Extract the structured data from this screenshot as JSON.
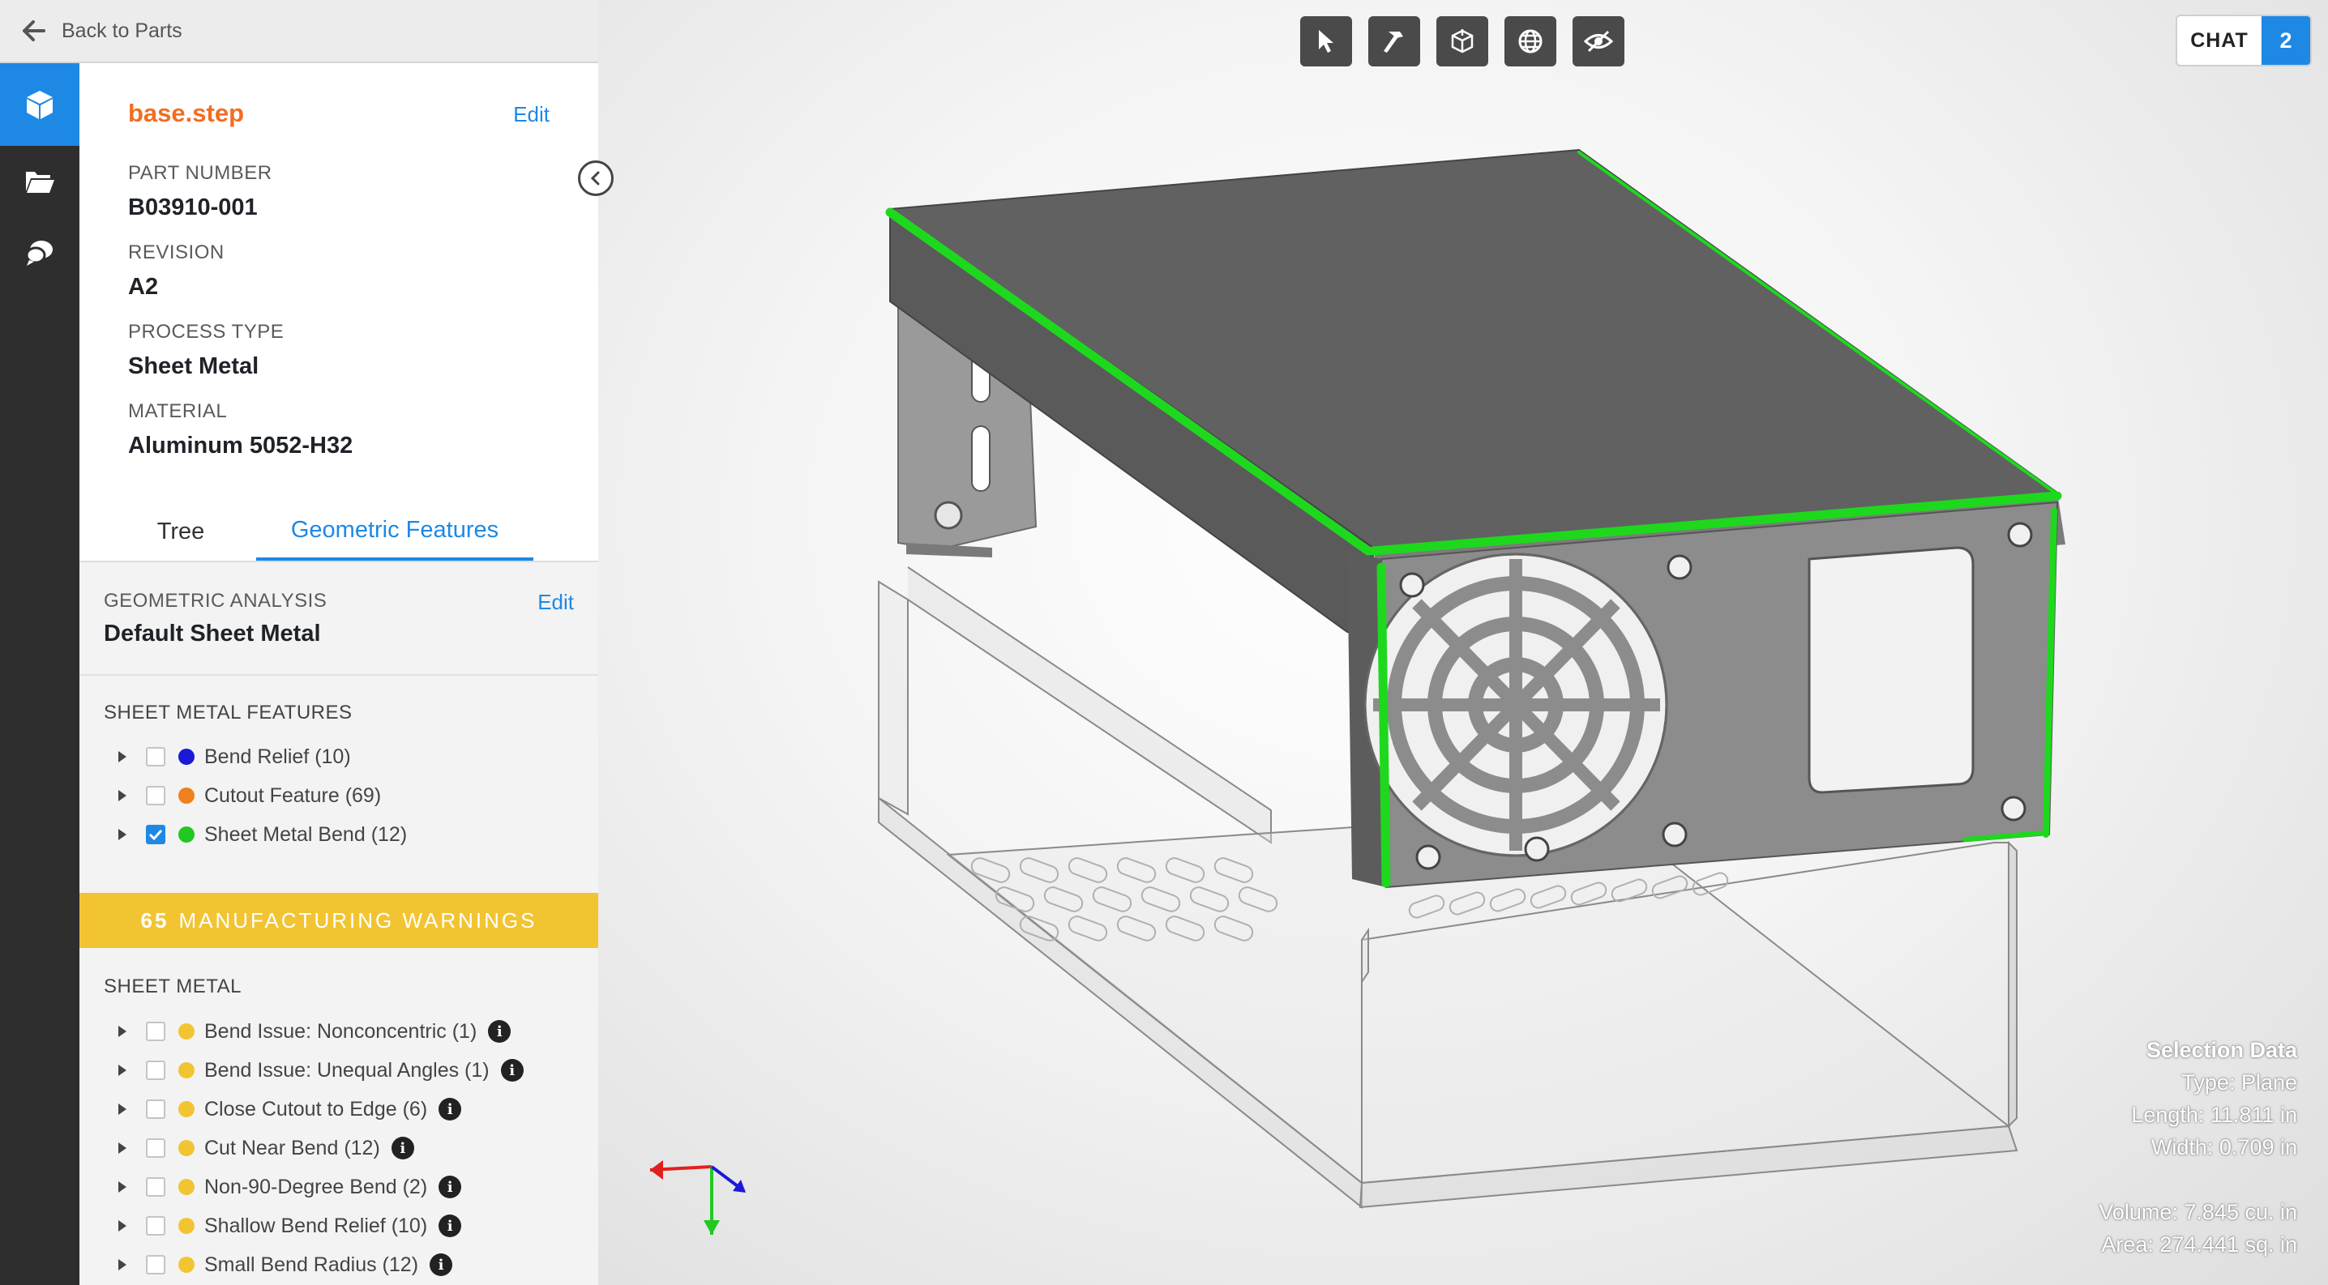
{
  "header": {
    "back_label": "Back to Parts"
  },
  "sidebar_rail": {
    "items": [
      {
        "icon": "cube-icon",
        "active": true
      },
      {
        "icon": "folder-icon",
        "active": false
      },
      {
        "icon": "chat-bubbles-icon",
        "active": false
      }
    ]
  },
  "part": {
    "filename": "base.step",
    "edit_label": "Edit",
    "properties": [
      {
        "label": "PART NUMBER",
        "value": "B03910-001"
      },
      {
        "label": "REVISION",
        "value": "A2"
      },
      {
        "label": "PROCESS TYPE",
        "value": "Sheet Metal"
      },
      {
        "label": "MATERIAL",
        "value": "Aluminum 5052-H32"
      }
    ]
  },
  "tabs": [
    {
      "label": "Tree",
      "active": false
    },
    {
      "label": "Geometric Features",
      "active": true
    }
  ],
  "geometric_analysis": {
    "label": "GEOMETRIC ANALYSIS",
    "edit_label": "Edit",
    "value": "Default Sheet Metal"
  },
  "sheet_metal_features": {
    "title": "SHEET METAL FEATURES",
    "items": [
      {
        "label": "Bend Relief (10)",
        "color": "#1a1ad6",
        "checked": false
      },
      {
        "label": "Cutout Feature (69)",
        "color": "#f07f1d",
        "checked": false
      },
      {
        "label": "Sheet Metal Bend (12)",
        "color": "#22c822",
        "checked": true
      }
    ]
  },
  "warnings": {
    "count": "65",
    "label": "MANUFACTURING WARNINGS"
  },
  "sheet_metal_warnings": {
    "title": "SHEET METAL",
    "items": [
      {
        "label": "Bend Issue: Nonconcentric (1)",
        "color": "#f2c432"
      },
      {
        "label": "Bend Issue: Unequal Angles (1)",
        "color": "#f2c432"
      },
      {
        "label": "Close Cutout to Edge (6)",
        "color": "#f2c432"
      },
      {
        "label": "Cut Near Bend (12)",
        "color": "#f2c432"
      },
      {
        "label": "Non-90-Degree Bend (2)",
        "color": "#f2c432"
      },
      {
        "label": "Shallow Bend Relief (10)",
        "color": "#f2c432"
      },
      {
        "label": "Small Bend Radius (12)",
        "color": "#f2c432"
      }
    ]
  },
  "toolbar": {
    "tools": [
      "pointer-icon",
      "hammer-icon",
      "axes-cube-icon",
      "globe-icon",
      "eye-slash-icon"
    ]
  },
  "chat": {
    "label": "CHAT",
    "count": "2"
  },
  "selection_data": {
    "title": "Selection Data",
    "type": "Type: Plane",
    "length": "Length: 11.811 in",
    "width": "Width: 0.709 in",
    "volume": "Volume: 7.845 cu. in",
    "area": "Area: 274.441 sq. in"
  },
  "colors": {
    "accent": "#1e88e5",
    "brand": "#f26d21",
    "warning": "#f2c432",
    "highlight_edge": "#1ed81e"
  }
}
